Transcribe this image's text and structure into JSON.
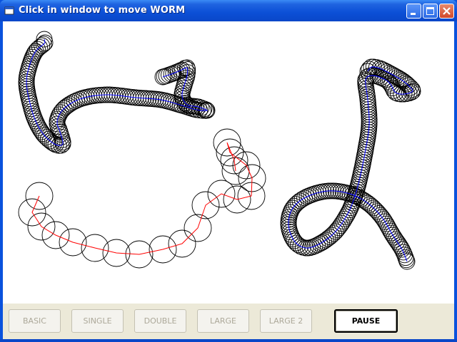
{
  "window": {
    "title": "Click in window to move WORM"
  },
  "title_buttons": [
    "minimize",
    "maximize",
    "close"
  ],
  "buttons": [
    {
      "label": "BASIC",
      "enabled": false
    },
    {
      "label": "SINGLE",
      "enabled": false
    },
    {
      "label": "DOUBLE",
      "enabled": false
    },
    {
      "label": "LARGE",
      "enabled": false
    },
    {
      "label": "LARGE 2",
      "enabled": false
    },
    {
      "label": "PAUSE",
      "enabled": true
    }
  ],
  "colors": {
    "titlebar": "#0a52dd",
    "small_worm_line": "#0000ff",
    "large_worm_line": "#ff0000",
    "circle_outline": "#000000"
  }
}
